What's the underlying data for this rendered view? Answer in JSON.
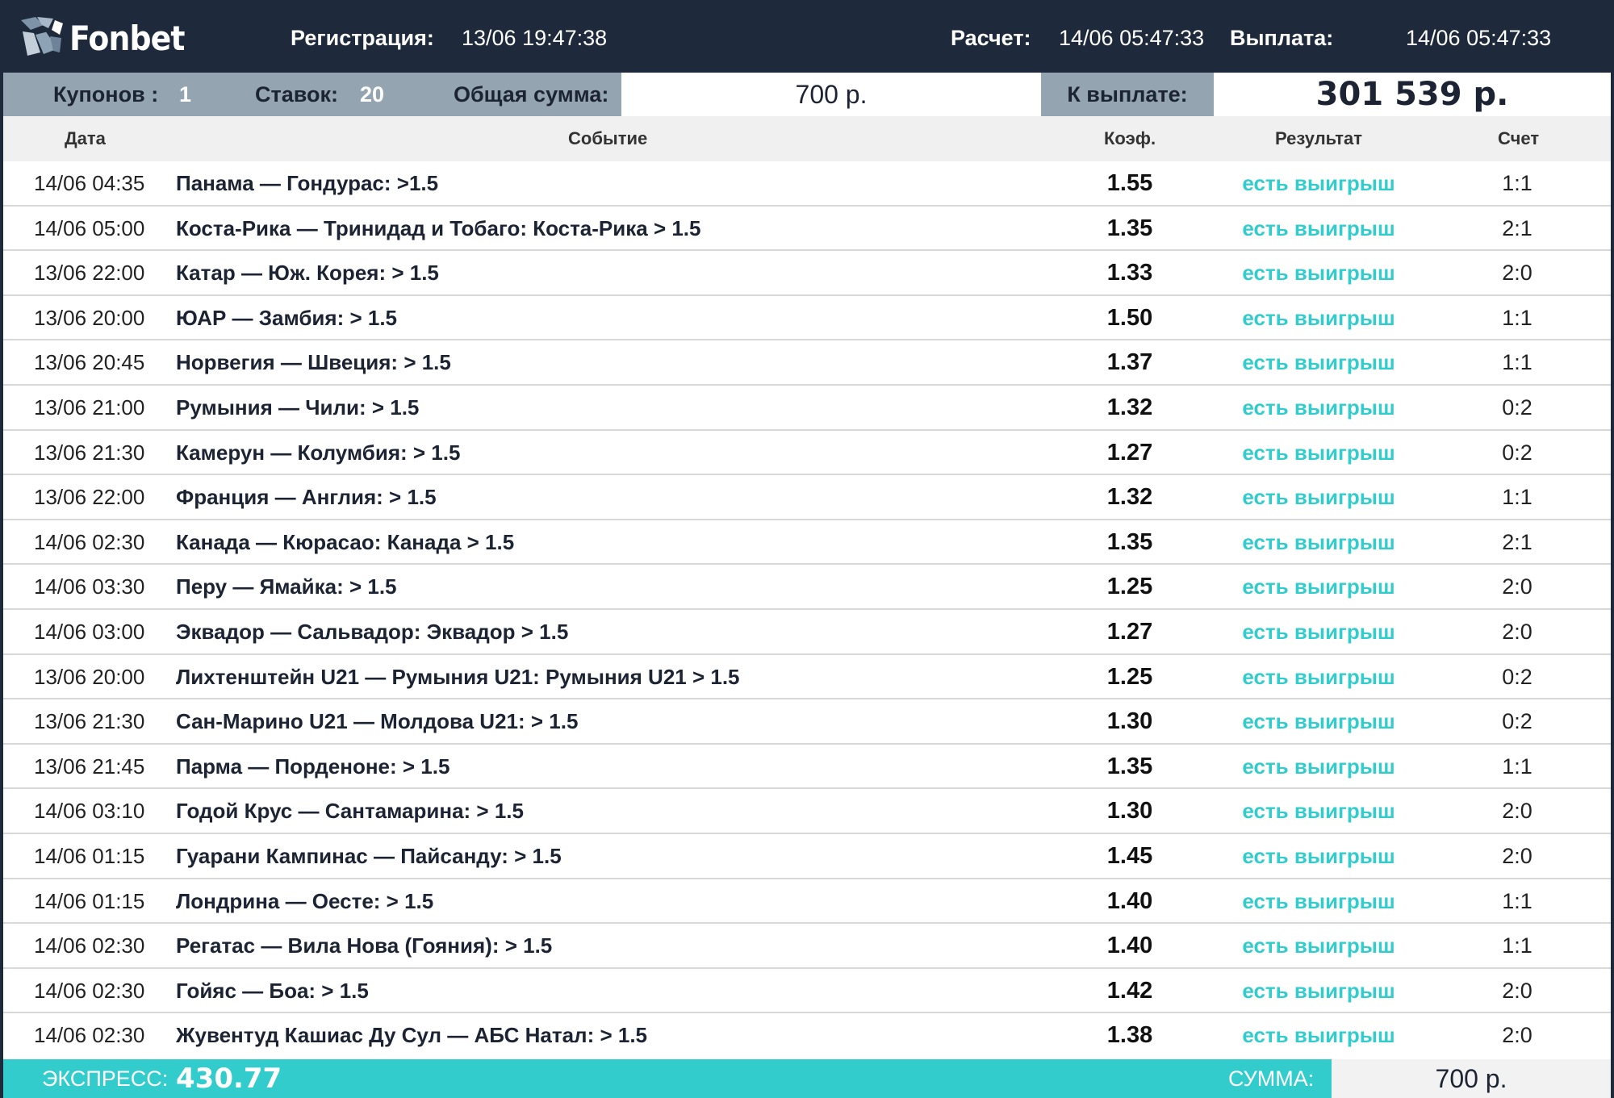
{
  "brand": {
    "name": "Fonbet"
  },
  "colors": {
    "header_bg": "#1e2a3c",
    "summary_bg": "#94a4b1",
    "accent_teal": "#33cccc",
    "win_text": "#33cccc"
  },
  "header": {
    "registration_label": "Регистрация:",
    "registration_time": "13/06  19:47:38",
    "settlement_label": "Расчет:",
    "settlement_time": "14/06  05:47:33",
    "payout_label": "Выплата:",
    "payout_time": "14/06 05:47:33"
  },
  "summary": {
    "coupons_label": "Купонов :",
    "coupons_value": "1",
    "bets_label": "Ставок:",
    "bets_value": "20",
    "total_label": "Общая сумма:",
    "total_value": "700 р.",
    "to_pay_label": "К выплате:",
    "to_pay_value": "301 539 р."
  },
  "columns": {
    "date": "Дата",
    "event": "Событие",
    "coef": "Коэф.",
    "result": "Результат",
    "score": "Счет"
  },
  "rows": [
    {
      "date": "14/06 04:35",
      "event": "Панама — Гондурас: >1.5",
      "coef": "1.55",
      "result": "есть выигрыш",
      "score": "1:1"
    },
    {
      "date": "14/06 05:00",
      "event": "Коста-Рика — Тринидад и Тобаго: Коста-Рика > 1.5",
      "coef": "1.35",
      "result": "есть выигрыш",
      "score": "2:1"
    },
    {
      "date": "13/06 22:00",
      "event": "Катар — Юж. Корея: > 1.5",
      "coef": "1.33",
      "result": "есть выигрыш",
      "score": "2:0"
    },
    {
      "date": "13/06 20:00",
      "event": "ЮАР — Замбия: > 1.5",
      "coef": "1.50",
      "result": "есть выигрыш",
      "score": "1:1"
    },
    {
      "date": "13/06 20:45",
      "event": "Норвегия — Швеция: > 1.5",
      "coef": "1.37",
      "result": "есть выигрыш",
      "score": "1:1"
    },
    {
      "date": "13/06 21:00",
      "event": "Румыния — Чили: > 1.5",
      "coef": "1.32",
      "result": "есть выигрыш",
      "score": "0:2"
    },
    {
      "date": "13/06 21:30",
      "event": "Камерун — Колумбия: > 1.5",
      "coef": "1.27",
      "result": "есть выигрыш",
      "score": "0:2"
    },
    {
      "date": "13/06 22:00",
      "event": "Франция — Англия: > 1.5",
      "coef": "1.32",
      "result": "есть выигрыш",
      "score": "1:1"
    },
    {
      "date": "14/06 02:30",
      "event": "Канада — Кюрасао: Канада > 1.5",
      "coef": "1.35",
      "result": "есть выигрыш",
      "score": "2:1"
    },
    {
      "date": "14/06 03:30",
      "event": "Перу — Ямайка: > 1.5",
      "coef": "1.25",
      "result": "есть выигрыш",
      "score": "2:0"
    },
    {
      "date": "14/06 03:00",
      "event": "Эквадор — Сальвадор: Эквадор > 1.5",
      "coef": "1.27",
      "result": "есть выигрыш",
      "score": "2:0"
    },
    {
      "date": "13/06 20:00",
      "event": "Лихтенштейн U21 — Румыния U21: Румыния U21 > 1.5",
      "coef": "1.25",
      "result": "есть выигрыш",
      "score": "0:2"
    },
    {
      "date": "13/06 21:30",
      "event": "Сан-Марино U21 — Молдова U21: > 1.5",
      "coef": "1.30",
      "result": "есть выигрыш",
      "score": "0:2"
    },
    {
      "date": "13/06 21:45",
      "event": "Парма — Порденоне: > 1.5",
      "coef": "1.35",
      "result": "есть выигрыш",
      "score": "1:1"
    },
    {
      "date": "14/06 03:10",
      "event": "Годой Крус — Сантамарина: > 1.5",
      "coef": "1.30",
      "result": "есть выигрыш",
      "score": "2:0"
    },
    {
      "date": "14/06 01:15",
      "event": "Гуарани Кампинас — Пайсанду: > 1.5",
      "coef": "1.45",
      "result": "есть выигрыш",
      "score": "2:0"
    },
    {
      "date": "14/06 01:15",
      "event": "Лондрина — Оесте: > 1.5",
      "coef": "1.40",
      "result": "есть выигрыш",
      "score": "1:1"
    },
    {
      "date": "14/06 02:30",
      "event": "Регатас — Вила Нова (Гояния): > 1.5",
      "coef": "1.40",
      "result": "есть выигрыш",
      "score": "1:1"
    },
    {
      "date": "14/06 02:30",
      "event": "Гойяс — Боа: > 1.5",
      "coef": "1.42",
      "result": "есть выигрыш",
      "score": "2:0"
    },
    {
      "date": "14/06 02:30",
      "event": "Жувентуд Кашиас Ду Сул — АБС Натал: > 1.5",
      "coef": "1.38",
      "result": "есть выигрыш",
      "score": "2:0"
    }
  ],
  "footer": {
    "express_label": "ЭКСПРЕСС:",
    "express_value": "430.77",
    "sum_label": "СУММА:",
    "sum_value": "700 р."
  }
}
